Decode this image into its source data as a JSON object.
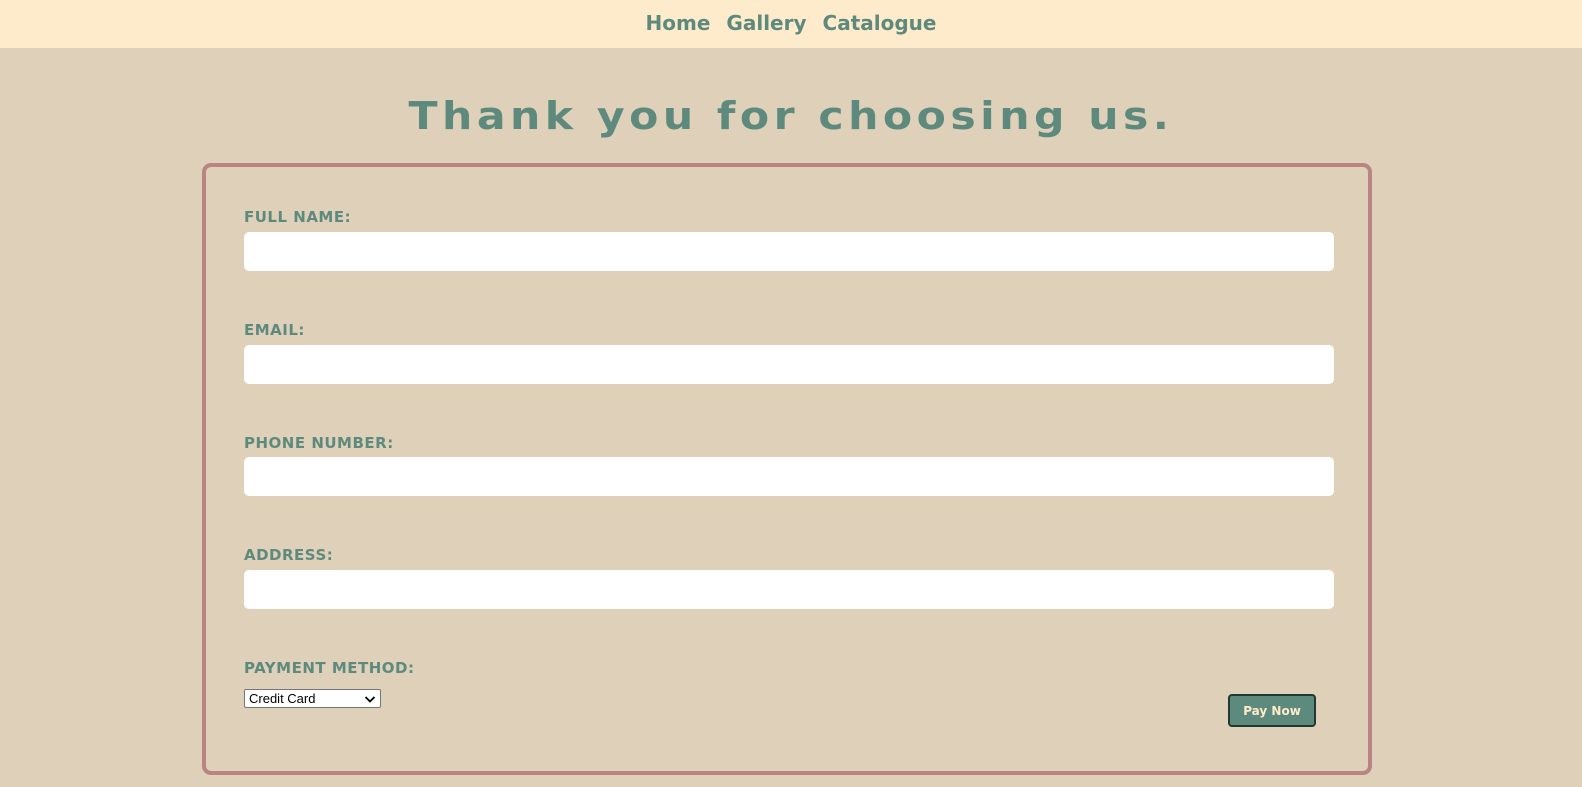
{
  "nav": {
    "items": [
      {
        "label": "Home"
      },
      {
        "label": "Gallery"
      },
      {
        "label": "Catalogue"
      }
    ]
  },
  "heading": "Thank you for choosing us.",
  "form": {
    "fields": [
      {
        "label": "FULL NAME:",
        "value": "",
        "placeholder": ""
      },
      {
        "label": "EMAIL:",
        "value": "",
        "placeholder": ""
      },
      {
        "label": "PHONE NUMBER:",
        "value": "",
        "placeholder": ""
      },
      {
        "label": "ADDRESS:",
        "value": "",
        "placeholder": ""
      }
    ],
    "payment": {
      "label": "PAYMENT METHOD:",
      "selected": "Credit Card"
    },
    "submit_label": "Pay Now"
  },
  "colors": {
    "page_background": "#ded0b9",
    "nav_background": "#feebcc",
    "accent_text": "#5e8a7e",
    "card_border": "#b88582",
    "button_background": "#5e8a7e",
    "button_text": "#feebcc"
  },
  "icons": {
    "select_arrow": "chevron-down-icon"
  }
}
